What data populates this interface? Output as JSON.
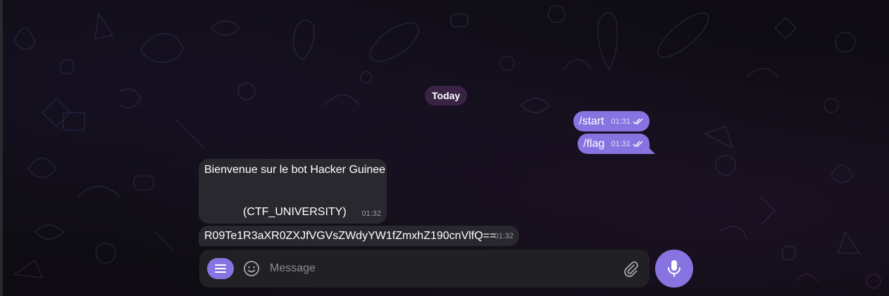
{
  "chat": {
    "date_separator": "Today",
    "messages": [
      {
        "direction": "outgoing",
        "text": "/start",
        "time": "01:31",
        "status": "read"
      },
      {
        "direction": "outgoing",
        "text": "/flag",
        "time": "01:31",
        "status": "read"
      },
      {
        "direction": "incoming",
        "text_line1": "Bienvenue sur le bot Hacker Guinee",
        "text_line2": "(CTF_UNIVERSITY)",
        "time": "01:32"
      },
      {
        "direction": "incoming",
        "text": "R09Te1R3aXR0ZXJfVGVsZWdyYW1fZmxhZ190cnVlfQ==",
        "time": "01:32"
      }
    ]
  },
  "composer": {
    "placeholder": "Message",
    "value": "",
    "menu_icon": "menu-icon",
    "emoji_icon": "smile-icon",
    "attach_icon": "paperclip-icon",
    "send_icon": "microphone-icon"
  },
  "colors": {
    "accent": "#8774e1",
    "incoming_bubble": "#2a282f",
    "date_pill": "#3a2446",
    "composer_bg": "#212024"
  }
}
